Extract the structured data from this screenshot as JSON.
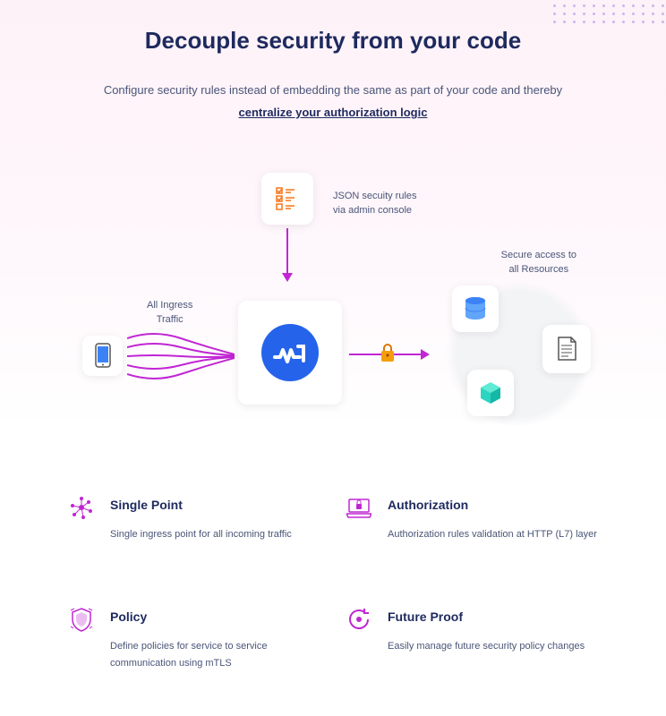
{
  "heading": "Decouple security from your code",
  "subheading": "Configure security rules instead of embedding the same as part of your code and thereby",
  "link_text": "centralize your authorization logic",
  "diagram": {
    "rules_label_line1": "JSON secuity rules",
    "rules_label_line2": "via admin console",
    "ingress_label_line1": "All Ingress",
    "ingress_label_line2": "Traffic",
    "resources_label_line1": "Secure access to",
    "resources_label_line2": "all Resources"
  },
  "features": [
    {
      "title": "Single Point",
      "desc": "Single ingress point for all incoming traffic"
    },
    {
      "title": "Authorization",
      "desc": "Authorization rules validation at HTTP (L7) layer"
    },
    {
      "title": "Policy",
      "desc": "Define policies for service to service communication using mTLS"
    },
    {
      "title": "Future Proof",
      "desc": "Easily manage future security policy changes"
    }
  ]
}
